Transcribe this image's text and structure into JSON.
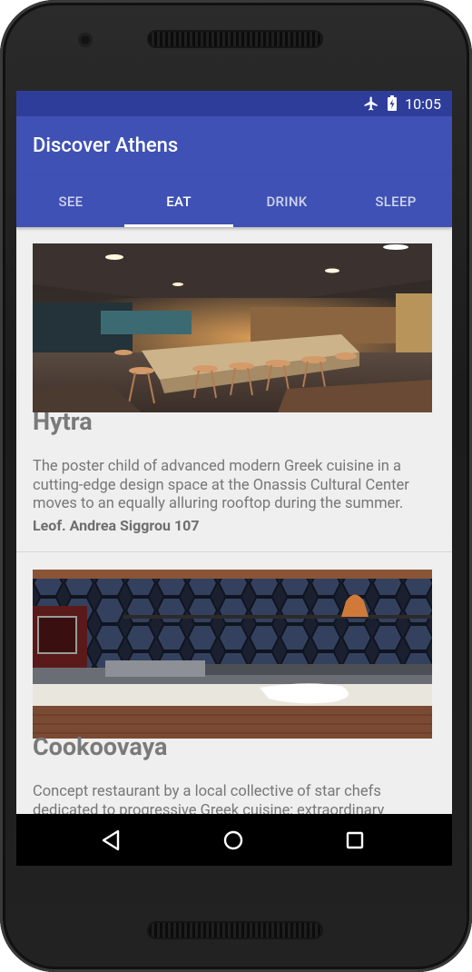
{
  "status_bar": {
    "time": "10:05",
    "icons": [
      "airplane-mode-icon",
      "battery-charging-icon"
    ]
  },
  "app_bar": {
    "title": "Discover Athens"
  },
  "tabs": [
    {
      "label": "SEE",
      "active": false
    },
    {
      "label": "EAT",
      "active": true
    },
    {
      "label": "DRINK",
      "active": false
    },
    {
      "label": "SLEEP",
      "active": false
    }
  ],
  "places": [
    {
      "name": "Hytra",
      "description": "The poster child of advanced modern Greek cuisine in a cutting-edge design space at the Onassis Cultural Center moves to an equally alluring rooftop during the summer.",
      "address": "Leof. Andrea Siggrou 107",
      "image": "restaurant-interior-photo"
    },
    {
      "name": "Cookoovaya",
      "description": "Concept restaurant by a local collective of star chefs dedicated to progressive Greek cuisine; extraordinary",
      "image": "open-kitchen-photo"
    }
  ],
  "nav_bar": {
    "buttons": [
      "back-icon",
      "home-icon",
      "recents-icon"
    ]
  },
  "colors": {
    "primary": "#3f51b5",
    "primary_dark": "#2f3d9a",
    "background": "#efefef"
  }
}
